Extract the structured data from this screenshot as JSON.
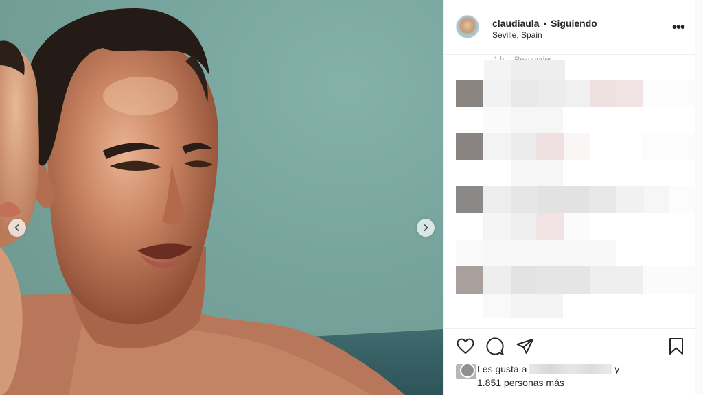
{
  "post": {
    "username": "claudiaula",
    "separator": "•",
    "follow_status": "Siguiendo",
    "location": "Seville, Spain",
    "more_label": "•••"
  },
  "comments": {
    "cut_time": "1 h",
    "cut_reply": "Responder"
  },
  "likes": {
    "prefix": "Les gusta a",
    "suffix": "y",
    "count_text": "1.851 personas más"
  },
  "icons": [
    "chevron-left-icon",
    "chevron-right-icon",
    "more-icon",
    "heart-icon",
    "comment-icon",
    "share-icon",
    "bookmark-icon"
  ],
  "colors": {
    "photo_sky": "#76a39b",
    "text": "#262626",
    "divider": "#efefef",
    "muted": "#8e8e8e"
  }
}
